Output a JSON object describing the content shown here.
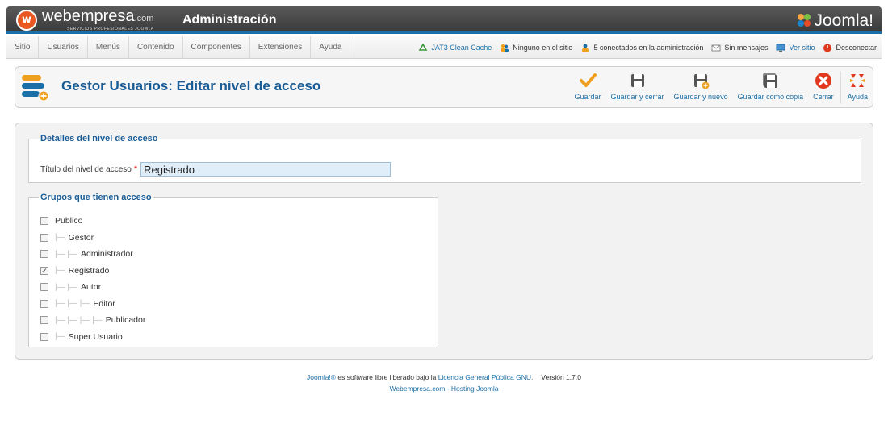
{
  "header": {
    "brand_name": "webempresa",
    "brand_suffix": ".com",
    "brand_tagline": "SERVICIOS PROFESIONALES JOOMLA",
    "admin_title": "Administración",
    "joomla_label": "Joomla!"
  },
  "menu": {
    "items": [
      "Sitio",
      "Usuarios",
      "Menús",
      "Contenido",
      "Componentes",
      "Extensiones",
      "Ayuda"
    ]
  },
  "status": {
    "cache": "JAT3 Clean Cache",
    "site_users": "Ninguno en el sitio",
    "admin_users": "5 conectados en la administración",
    "messages": "Sin mensajes",
    "view_site": "Ver sitio",
    "logout": "Desconectar"
  },
  "toolbar": {
    "page_title": "Gestor Usuarios: Editar nivel de acceso",
    "save": "Guardar",
    "save_close": "Guardar y cerrar",
    "save_new": "Guardar y nuevo",
    "save_copy": "Guardar como copia",
    "close": "Cerrar",
    "help": "Ayuda"
  },
  "details": {
    "legend": "Detalles del nivel de acceso",
    "title_label": "Título del nivel de acceso",
    "required_mark": "*",
    "title_value": "Registrado"
  },
  "groups": {
    "legend": "Grupos que tienen acceso",
    "items": [
      {
        "label": "Publico",
        "level": 0,
        "checked": false
      },
      {
        "label": "Gestor",
        "level": 1,
        "checked": false
      },
      {
        "label": "Administrador",
        "level": 2,
        "checked": false
      },
      {
        "label": "Registrado",
        "level": 1,
        "checked": true
      },
      {
        "label": "Autor",
        "level": 2,
        "checked": false
      },
      {
        "label": "Editor",
        "level": 3,
        "checked": false
      },
      {
        "label": "Publicador",
        "level": 4,
        "checked": false
      },
      {
        "label": "Super Usuario",
        "level": 1,
        "checked": false
      }
    ]
  },
  "footer": {
    "joomla_link": "Joomla!®",
    "text_mid": " es software libre liberado bajo la ",
    "license_link": "Licencia General Pública GNU.",
    "version": "Versión 1.7.0",
    "hosting": "Webempresa.com - Hosting Joomla"
  },
  "colors": {
    "accent": "#1a6fa8",
    "title_blue": "#1a5c95",
    "save_orange": "#f0a020",
    "close_red": "#e03a1e"
  }
}
